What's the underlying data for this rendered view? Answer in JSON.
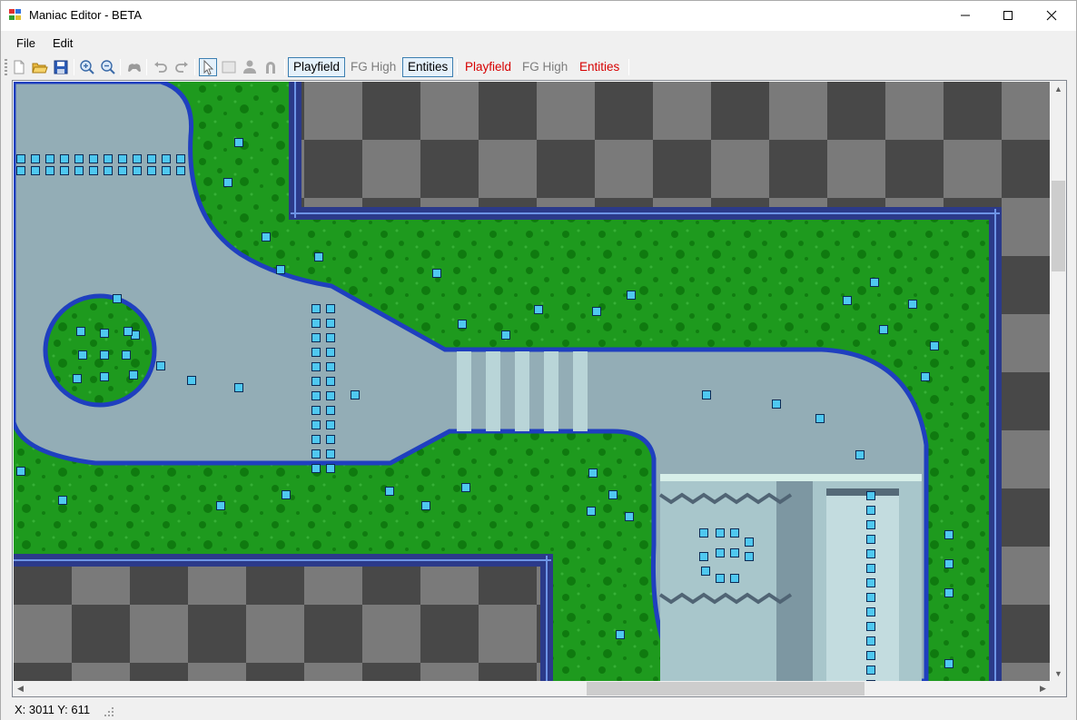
{
  "window": {
    "title": "Maniac Editor - BETA",
    "controls": {
      "minimize": "minimize",
      "maximize": "maximize",
      "close": "close"
    }
  },
  "menu": {
    "items": [
      {
        "label": "File"
      },
      {
        "label": "Edit"
      }
    ]
  },
  "toolbar": {
    "icons": [
      "new-file-icon",
      "open-folder-icon",
      "save-icon",
      "zoom-in-icon",
      "zoom-out-icon",
      "gamepad-icon",
      "undo-icon",
      "redo-icon",
      "pointer-icon",
      "select-rect-icon",
      "person-icon",
      "magnet-icon"
    ],
    "layers_a": {
      "playfield": "Playfield",
      "fg_high": "FG High",
      "entities": "Entities"
    },
    "layers_b": {
      "playfield": "Playfield",
      "fg_high": "FG High",
      "entities": "Entities"
    }
  },
  "status": {
    "coords": "X: 3011 Y: 611"
  },
  "colors": {
    "grass": "#1e9a1e",
    "water": "#93adb6",
    "border": "#1f3fbf",
    "entity": "#4fc8f0",
    "checker_dark": "#484848",
    "checker_light": "#7a7a7a",
    "accent_red": "#d60000"
  }
}
